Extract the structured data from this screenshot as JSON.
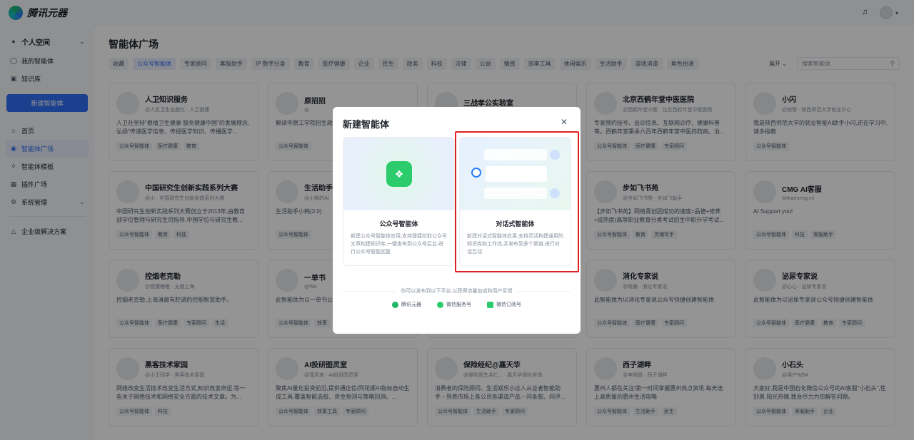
{
  "app": {
    "name": "腾讯元器"
  },
  "sidebar": {
    "space": "个人空间",
    "items_top": [
      {
        "label": "我的智能体",
        "icon": "robot-icon"
      },
      {
        "label": "知识库",
        "icon": "book-icon"
      }
    ],
    "new_button": "新建智能体",
    "items_nav": [
      {
        "label": "首页",
        "icon": "home-icon"
      },
      {
        "label": "智能体广场",
        "icon": "compass-icon"
      },
      {
        "label": "智能体模板",
        "icon": "template-icon"
      },
      {
        "label": "插件广场",
        "icon": "plugin-icon"
      },
      {
        "label": "系统管理",
        "icon": "settings-icon"
      }
    ],
    "enterprise": "企业级解决方案"
  },
  "main": {
    "title": "智能体广场",
    "tabs": [
      "收藏",
      "公众号智能体",
      "专家顾问",
      "客服助手",
      "IP 数字分身",
      "教育",
      "医疗健康",
      "企业",
      "民生",
      "政务",
      "科技",
      "法律",
      "公益",
      "情感",
      "效率工具",
      "休闲娱乐",
      "生活助手",
      "游戏消遣",
      "角色扮演"
    ],
    "active_tab": "公众号智能体",
    "expand": "展开",
    "search_placeholder": "搜索智能体"
  },
  "cards": [
    {
      "title": "人卫知识服务",
      "sub": "@人民卫生出版社 · 人卫健康",
      "desc": "人卫社坚持\"根植卫生健康 服务健康中国\"的发展理念,弘扬\"传递医学信息、传授医学知识、传播医学...",
      "tags": [
        "公众号智能体",
        "医疗健康",
        "教育"
      ]
    },
    {
      "title": "原招招",
      "sub": "@ ·",
      "desc": "解读中原工学院招生政...",
      "tags": [
        "公众号智能体"
      ]
    },
    {
      "title": "三战孝公实验室",
      "sub": "",
      "desc": "",
      "tags": []
    },
    {
      "title": "北京西鹤年堂中医医院",
      "sub": "@西鹤年堂中医 · 北京西鹤年堂中医医院",
      "desc": "专家预约挂号、出诊信息、互联网诊疗、健康科普等。西鹤年堂秉承六百年西鹤年堂中医药防病、治...",
      "tags": [
        "公众号智能体",
        "医疗健康",
        "专家顾问"
      ]
    },
    {
      "title": "小闪",
      "sub": "@统黎 · 陕西师范大学就业中心",
      "desc": "我是陕西师范大学的就业智能AI助手小闪,还在学习中,请多指教",
      "tags": [
        "公众号智能体"
      ]
    },
    {
      "title": "中国研究生创新实践系列大赛",
      "sub": "@小 · 中国研究生创新实践系列大赛",
      "desc": "中国研究生创新实践系列大赛创立于2013年,由教育部学位管理与研究生司指导,中国学位与研究生教...",
      "tags": [
        "公众号智能体",
        "教育",
        "科技"
      ]
    },
    {
      "title": "生活助手",
      "sub": "@小韩的AI",
      "desc": "生活助手小韩(3.0)",
      "tags": [
        "公众号智能体"
      ]
    },
    {
      "title": "",
      "sub": "",
      "desc": "",
      "tags": []
    },
    {
      "title": "步如飞书苑",
      "sub": "@步如飞书苑 · 步如飞助手",
      "desc": "【步如飞书苑】网络青创团成功的速度=品德+修养+成熟度(高等职业教育分类考试招生中职升学考试...",
      "tags": [
        "公众号智能体",
        "教育",
        "灵魂写手"
      ]
    },
    {
      "title": "CMG AI客服",
      "sub": "@learncmg.cn",
      "desc": "AI Support you!",
      "tags": [
        "公众号智能体",
        "科技",
        "客服助手"
      ]
    },
    {
      "title": "控烟老克勒",
      "sub": "@健康睡眠 · 无烟上海",
      "desc": "控烟老克勒,上海滩最有腔调的控烟智慧助手。",
      "tags": [
        "公众号智能体",
        "医疗健康",
        "专家顾问",
        "生活"
      ]
    },
    {
      "title": "一单书",
      "sub": "@Wo",
      "desc": "此智能体为以一单书公...",
      "tags": [
        "公众号智能体",
        "效率"
      ]
    },
    {
      "title": "",
      "sub": "",
      "desc": "",
      "tags": []
    },
    {
      "title": "消化专家说",
      "sub": "@晓晨 · 消化专家说",
      "desc": "此智能体为以消化专家说公众号快捷创建智能体",
      "tags": [
        "公众号智能体",
        "医疗健康",
        "专家顾问"
      ]
    },
    {
      "title": "泌尿专家说",
      "sub": "@心心 · 泌尿专家说",
      "desc": "此智能体为以泌尿专家说公众号快捷创建智能体",
      "tags": [
        "公众号智能体",
        "医疗健康",
        "教育",
        "专家顾问"
      ]
    },
    {
      "title": "黑客技术家园",
      "sub": "@小王同学 · 黑客技术家园",
      "desc": "网络改变生活技术改变生活方式,知识改变命运,等一些关于网络技术和网络安全方面的技术文章。为...",
      "tags": [
        "公众号智能体",
        "科技"
      ]
    },
    {
      "title": "AI投研图灵室",
      "sub": "@尊风来 · AI投研图灵室",
      "desc": "聚焦AI量化投资前沿,提供通达信/同花顺AI指标自动生成工具,覆盖智能选股、资金预测与策略回测。...",
      "tags": [
        "公众号智能体",
        "效率工具",
        "专家顾问"
      ]
    },
    {
      "title": "保险经纪@嘉天华",
      "sub": "@保险医生余仁... · 嘉天华保险咨询",
      "desc": "消费者的保险顾问、生活娱乐小达人从业者智能助手・熟悉市场上各公司各渠道产品・问条款、问评...",
      "tags": [
        "公众号智能体",
        "生活助手",
        "专家顾问"
      ]
    },
    {
      "title": "西子湖畔",
      "sub": "@李佩佩 · 西子湖畔",
      "desc": "惠州人都在关注!第一时间掌握惠州热点资讯,每天连上高质量的惠州生活攻略",
      "tags": [
        "公众号智能体",
        "生活助手",
        "民生"
      ]
    },
    {
      "title": "小石头",
      "sub": "@用户9d94",
      "desc": "大家好,我是中国石化微信公众号的AI客服\"小石头\",性别男,阳光热情,我会尽力为您解答问题。",
      "tags": [
        "公众号智能体",
        "客服助手",
        "企业"
      ]
    }
  ],
  "modal": {
    "title": "新建智能体",
    "option1": {
      "name": "公众号智能体",
      "desc": "新建公众号智能体应用,支持便捷拉取公众号文章构建知识库,一键发布到公众号后台,进行公众号智能回复"
    },
    "option2": {
      "name": "对话式智能体",
      "desc": "新建对话式智能体应用,支持灵活构建通用的知识库和工作流,并发布到多个渠道,进行对话互动"
    },
    "publish_note": "你可以发布到以下平台,以获得流量加成和用户反馈",
    "platforms": [
      {
        "label": "腾讯元器",
        "color": "#1fb86b"
      },
      {
        "label": "微信服务号",
        "color": "#2ccb6b"
      },
      {
        "label": "微信订阅号",
        "color": "#2ccb6b"
      }
    ]
  }
}
